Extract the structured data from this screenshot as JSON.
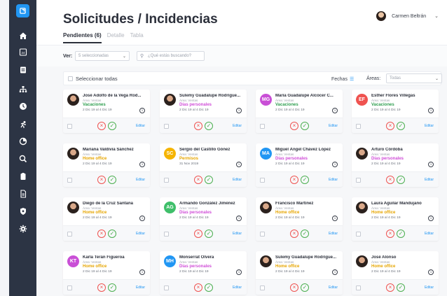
{
  "colors": {
    "sidebar": "#2c3444",
    "accent": "#2196f3",
    "vacaciones": "#2e9e4f",
    "dias": "#d04ed8",
    "home": "#e6a500",
    "permisos": "#e6a500"
  },
  "header": {
    "title": "Solicitudes / Incidencias",
    "user_name": "Carmen Beltrán",
    "tabs": [
      "Pendientes (6)",
      "Detalle",
      "Tabla"
    ]
  },
  "filters": {
    "ver_label": "Ver:",
    "ver_value": "5 seleccionadas",
    "search_placeholder": "¿Qué estás buscando?"
  },
  "toolbar": {
    "select_all": "Seleccionar todas",
    "fechas": "Fechas",
    "areas_label": "Áreas:",
    "areas_value": "Todas"
  },
  "card_labels": {
    "edit": "Editar",
    "info": "i"
  },
  "cards": [
    {
      "name": "José Adolfo de la Vega Rod...",
      "area": "Área: Ventas",
      "type": "Vacaciones",
      "kind": "vacaciones",
      "dates": "2 Dic 19  al  4 Dic 19",
      "initials": "",
      "avatar_color": ""
    },
    {
      "name": "Sulemy Guadalupe Rodrígue...",
      "area": "Área: Ventas",
      "type": "Días personales",
      "kind": "dias",
      "dates": "2 Dic 19  al  4 Dic 19",
      "initials": "",
      "avatar_color": ""
    },
    {
      "name": "María Guadalupe Alcocer C...",
      "area": "Área: Ventas",
      "type": "Vacaciones",
      "kind": "vacaciones",
      "dates": "2 Dic 19  al  4 Dic 19",
      "initials": "MG",
      "avatar_color": "#c94fd6"
    },
    {
      "name": "Esther Flores Villegas",
      "area": "Área: Ventas",
      "type": "Vacaciones",
      "kind": "vacaciones",
      "dates": "2 Dic 19  al  4 Dic 19",
      "initials": "EF",
      "avatar_color": "#ef5350"
    },
    {
      "name": "Mariana Valdivia Sánchez",
      "area": "Área: Ventas",
      "type": "Home office",
      "kind": "home",
      "dates": "2 Dic 19  al  4 Dic 19",
      "initials": "",
      "avatar_color": ""
    },
    {
      "name": "Sergio del Castillo Gónez",
      "area": "Área: Ventas",
      "type": "Permisos",
      "kind": "permisos",
      "dates": "31 Nov 2019",
      "initials": "SC",
      "avatar_color": "#f5b400"
    },
    {
      "name": "Miguel Ángel Chávez López",
      "area": "Área: Ventas",
      "type": "Días personales",
      "kind": "dias",
      "dates": "2 Dic 19  al  4 Dic 19",
      "initials": "MA",
      "avatar_color": "#2196f3"
    },
    {
      "name": "Arturo Córdoba",
      "area": "Área: Ventas",
      "type": "Días personales",
      "kind": "dias",
      "dates": "2 Dic 19  al  4 Dic 19",
      "initials": "",
      "avatar_color": ""
    },
    {
      "name": "Diego de la Cruz Santana",
      "area": "Área: Ventas",
      "type": "Home office",
      "kind": "home",
      "dates": "2 Dic 19  al  4 Dic 19",
      "initials": "",
      "avatar_color": ""
    },
    {
      "name": "Armando González Jiménez",
      "area": "Área: Ventas",
      "type": "Días personales",
      "kind": "dias",
      "dates": "2 Dic 19  al  4 Dic 19",
      "initials": "AG",
      "avatar_color": "#3fbf6a"
    },
    {
      "name": "Francisco Martínez",
      "area": "Área: Ventas",
      "type": "Home office",
      "kind": "home",
      "dates": "2 Dic 19  al  4 Dic 19",
      "initials": "",
      "avatar_color": ""
    },
    {
      "name": "Laura Aguilar Mandujano",
      "area": "Área: Ventas",
      "type": "Home office",
      "kind": "home",
      "dates": "2 Dic 19  al  4 Dic 19",
      "initials": "",
      "avatar_color": ""
    },
    {
      "name": "Karla Terán Figueroa",
      "area": "Área: Ventas",
      "type": "Home office",
      "kind": "home",
      "dates": "2 Dic 19  al  4 Dic 19",
      "initials": "KT",
      "avatar_color": "#c94fd6"
    },
    {
      "name": "Monserrat Olvera",
      "area": "Área: Ventas",
      "type": "Días personales",
      "kind": "dias",
      "dates": "2 Dic 19  al  4 Dic 19",
      "initials": "MH",
      "avatar_color": "#2196f3"
    },
    {
      "name": "Sulemy Guadalupe Rodrígue...",
      "area": "Área: Ventas",
      "type": "Home office",
      "kind": "home",
      "dates": "2 Dic 19  al  4 Dic 19",
      "initials": "",
      "avatar_color": ""
    },
    {
      "name": "José Alonso",
      "area": "Área: Ventas",
      "type": "Home office",
      "kind": "home",
      "dates": "2 Dic 19  al  4 Dic 19",
      "initials": "",
      "avatar_color": ""
    }
  ]
}
